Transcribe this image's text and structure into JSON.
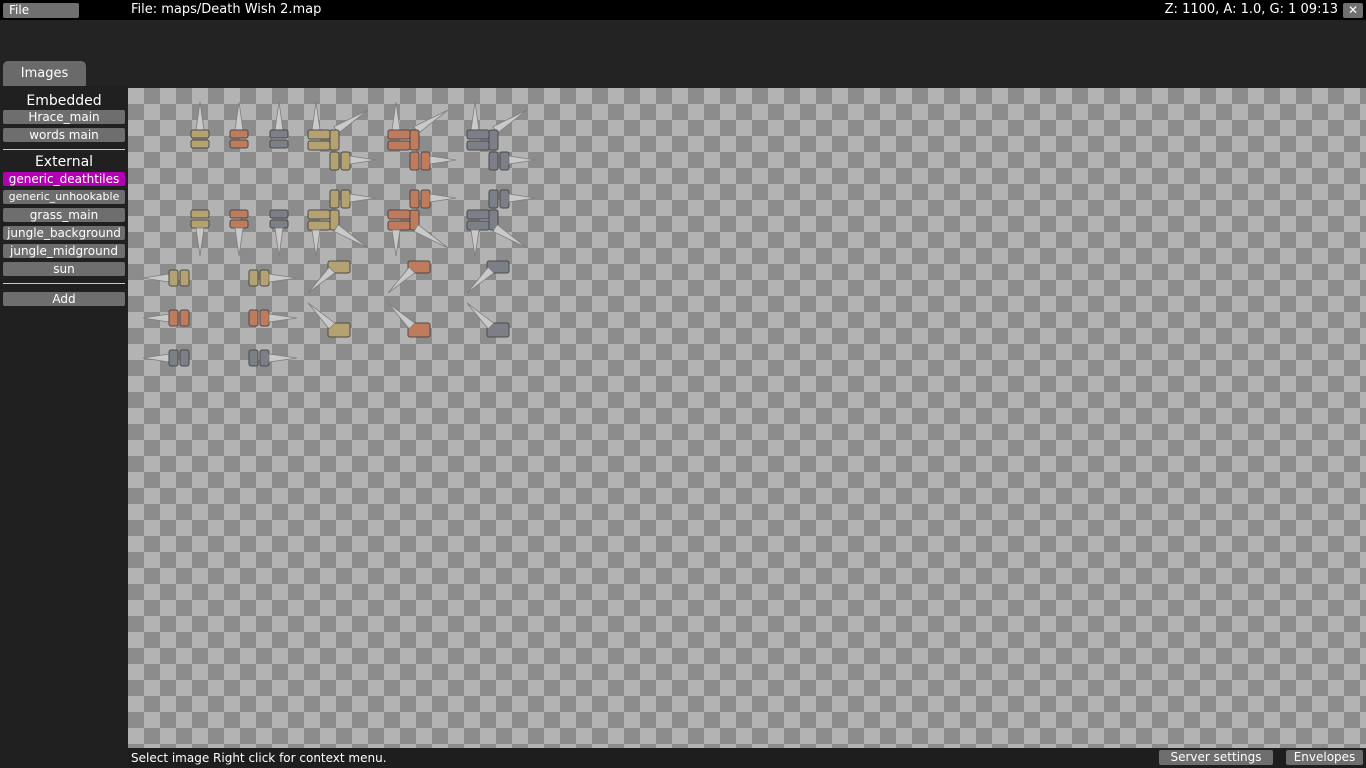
{
  "topbar": {
    "file_menu_label": "File",
    "file_path": "File: maps/Death Wish 2.map",
    "status": "Z: 1100, A: 1.0, G: 1  09:13",
    "close_label": "✕"
  },
  "tabs": {
    "images_label": "Images"
  },
  "sidebar": {
    "embedded_heading": "Embedded",
    "embedded_items": [
      "Hrace_main",
      "words main"
    ],
    "external_heading": "External",
    "external_items": [
      "generic_deathtiles",
      "generic_unhookable",
      "grass_main",
      "jungle_background",
      "jungle_midground",
      "sun"
    ],
    "selected_item": "generic_deathtiles",
    "add_label": "Add"
  },
  "bottombar": {
    "hint": "Select image Right click for context menu.",
    "server_settings_label": "Server settings",
    "envelopes_label": "Envelopes"
  },
  "colors": {
    "selected": "#b400b4",
    "button": "#6e6e6e",
    "tile_gold": "#b5a271",
    "tile_copper": "#c07a5c",
    "tile_steel": "#7c7f87"
  },
  "tileset": {
    "image": "generic_deathtiles",
    "materials": [
      "gold",
      "copper",
      "steel"
    ]
  }
}
